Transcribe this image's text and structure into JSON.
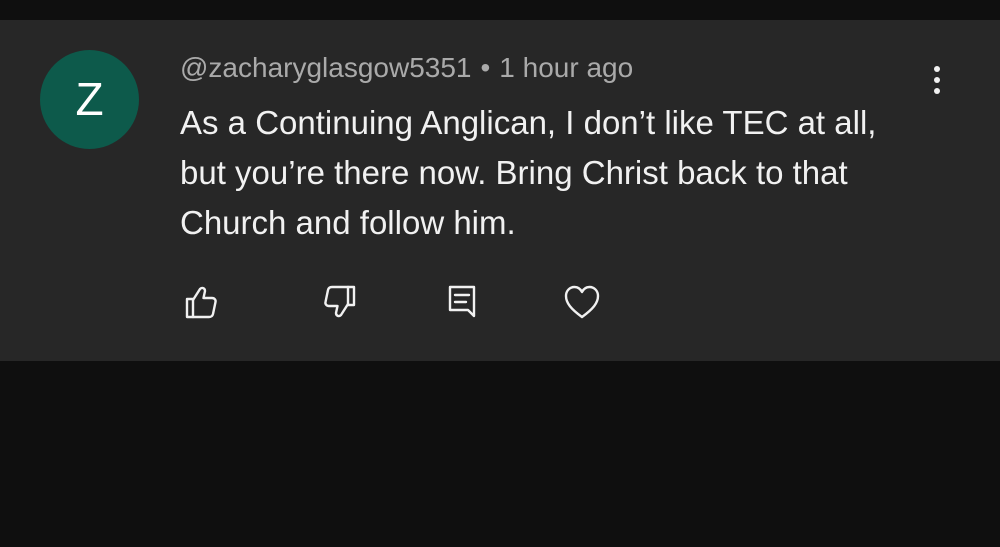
{
  "comment": {
    "avatar_letter": "Z",
    "avatar_color": "#0d5a4b",
    "author": "@zacharyglasgow5351",
    "separator": "•",
    "timestamp": "1 hour ago",
    "text": "As a Continuing Anglican, I don’t like TEC at all, but you’re there now. Bring Christ back to that Church and follow him."
  },
  "actions": {
    "like_icon": "thumbs-up-icon",
    "dislike_icon": "thumbs-down-icon",
    "reply_icon": "reply-comment-icon",
    "heart_icon": "heart-icon",
    "more_icon": "vertical-ellipsis-icon"
  },
  "colors": {
    "page_background": "#0f0f0f",
    "card_background": "#272727",
    "primary_text": "#f1f1f1",
    "secondary_text": "#aaaaaa"
  }
}
